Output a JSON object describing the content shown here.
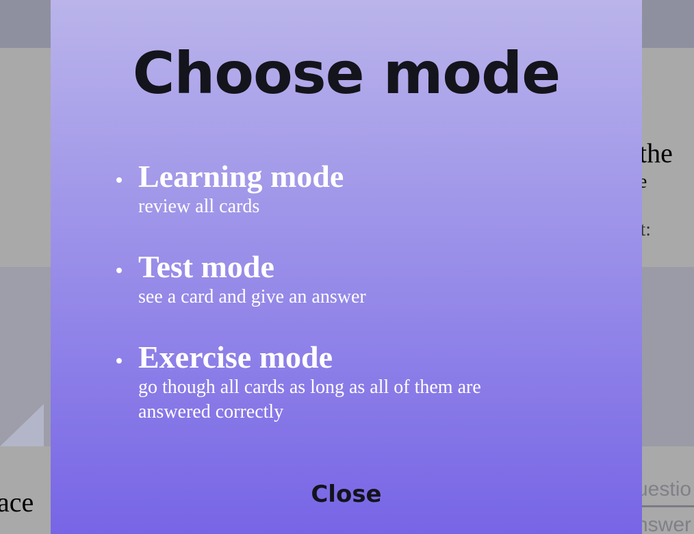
{
  "background": {
    "right_title_fragment": "n the",
    "right_subtitle_fragment": "ose",
    "right_meta_fragment": "rrect:",
    "left_bottom_fragment": "ace",
    "right_question_fragment": "uestio",
    "right_answer_fragment": "nswer",
    "edit_icon": "pencil-icon"
  },
  "modal": {
    "title": "Choose mode",
    "modes": [
      {
        "name": "Learning mode",
        "description": "review all cards"
      },
      {
        "name": "Test mode",
        "description": "see a card and give an answer"
      },
      {
        "name": "Exercise mode",
        "description": "go though all cards as long as all of them are answered correctly"
      }
    ],
    "close_label": "Close"
  },
  "colors": {
    "gradient_top": "#bab4ea",
    "gradient_bottom": "#7765e6",
    "overlay": "#8d8f9f",
    "title_text": "#14141c"
  }
}
